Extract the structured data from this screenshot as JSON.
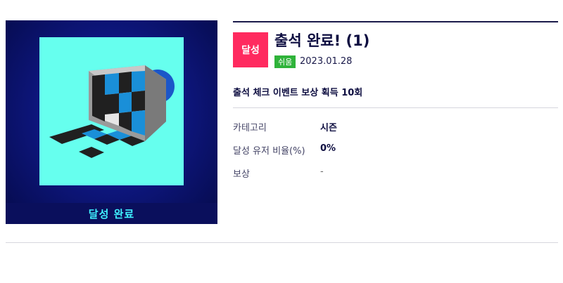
{
  "achievement": {
    "card_status": "달성 완료",
    "badge": "달성",
    "title": "출석 완료! (1)",
    "difficulty": "쉬움",
    "date": "2023.01.28",
    "description": "출석 체크 이벤트 보상 획득 10회",
    "icon": "calendar-check-icon"
  },
  "info": {
    "category_label": "카테고리",
    "category_value": "시즌",
    "rate_label": "달성 유저 비율(%)",
    "rate_value": "0%",
    "reward_label": "보상",
    "reward_value": "-"
  },
  "colors": {
    "card_bg": "#0e1780",
    "art_bg": "#66ffee",
    "badge": "#ff2a5f",
    "difficulty": "#2fb33a",
    "footer_text": "#3ff0ff"
  }
}
